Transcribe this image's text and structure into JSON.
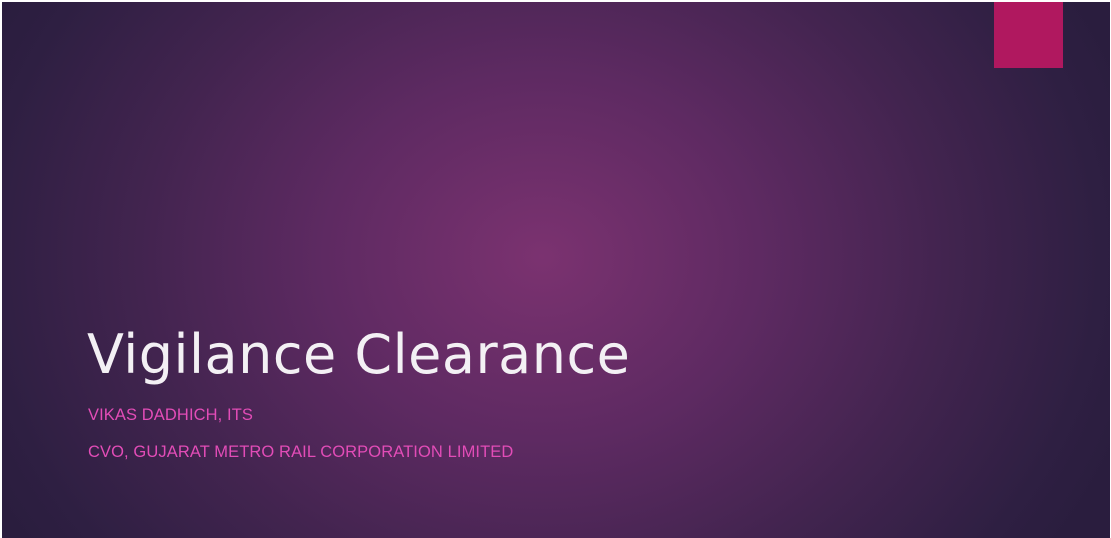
{
  "slide": {
    "title": "Vigilance Clearance",
    "subtitle_lines": [
      "VIKAS DADHICH, ITS",
      "CVO, GUJARAT METRO RAIL CORPORATION LIMITED"
    ]
  },
  "colors": {
    "background_center": "#7b3270",
    "background_edge": "#2a1d3e",
    "accent_square": "#b0185f",
    "title_text": "#f3f0f4",
    "subtitle_text": "#e24cb7"
  }
}
